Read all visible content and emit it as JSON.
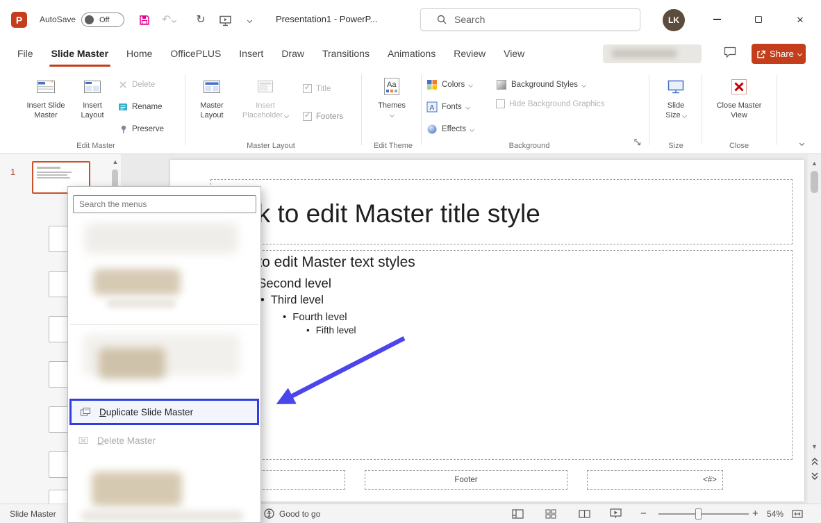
{
  "title_bar": {
    "autosave_label": "AutoSave",
    "autosave_state": "Off",
    "doc_title": "Presentation1 - PowerP...",
    "search_placeholder": "Search",
    "avatar_initials": "LK"
  },
  "tabs": [
    {
      "label": "File"
    },
    {
      "label": "Slide Master"
    },
    {
      "label": "Home"
    },
    {
      "label": "OfficePLUS"
    },
    {
      "label": "Insert"
    },
    {
      "label": "Draw"
    },
    {
      "label": "Transitions"
    },
    {
      "label": "Animations"
    },
    {
      "label": "Review"
    },
    {
      "label": "View"
    }
  ],
  "share_label": "Share",
  "ribbon": {
    "edit_master": {
      "group_label": "Edit Master",
      "insert_slide_master": "Insert Slide Master",
      "insert_layout": "Insert Layout",
      "delete": "Delete",
      "rename": "Rename",
      "preserve": "Preserve"
    },
    "master_layout": {
      "group_label": "Master Layout",
      "master_layout": "Master Layout",
      "insert_placeholder": "Insert Placeholder",
      "title": "Title",
      "footers": "Footers"
    },
    "edit_theme": {
      "group_label": "Edit Theme",
      "themes": "Themes"
    },
    "background": {
      "group_label": "Background",
      "colors": "Colors",
      "fonts": "Fonts",
      "effects": "Effects",
      "background_styles": "Background Styles",
      "hide_background_graphics": "Hide Background Graphics"
    },
    "size": {
      "group_label": "Size",
      "slide_size": "Slide Size"
    },
    "close": {
      "group_label": "Close",
      "close_master_view": "Close Master View"
    }
  },
  "thumbnails": {
    "slide_number": "1"
  },
  "context_menu": {
    "search_placeholder": "Search the menus",
    "items": [
      {
        "accel": "D",
        "rest": "uplicate Slide Master"
      },
      {
        "accel": "D",
        "rest": "elete Master"
      }
    ]
  },
  "slide": {
    "title_text": "Click to edit Master title style",
    "body_lines": [
      {
        "bullet": "",
        "text": "Click to edit Master text styles"
      },
      {
        "bullet": "",
        "text": "Second level"
      },
      {
        "bullet": "•",
        "text": "Third level"
      },
      {
        "bullet": "•",
        "text": "Fourth level"
      },
      {
        "bullet": "•",
        "text": "Fifth level"
      }
    ],
    "footer_text": "Footer",
    "slide_number_placeholder": "<#>"
  },
  "status_bar": {
    "view_label": "Slide Master",
    "accessibility": "Good to go",
    "zoom_level": "54%"
  },
  "icons": {
    "undo": "↶",
    "redo": "↻",
    "scroll_up": "▲",
    "scroll_down": "▼",
    "zoom_out": "−",
    "zoom_in": "+",
    "window_close": "×"
  },
  "colors": {
    "brand_red": "#C43E1C",
    "highlight_blue": "#2E3EE0",
    "arrow_blue": "#4B45EC",
    "save_pink": "#E3008C",
    "close_x_red": "#C00000",
    "avatar_brown": "#5D4B3C"
  }
}
